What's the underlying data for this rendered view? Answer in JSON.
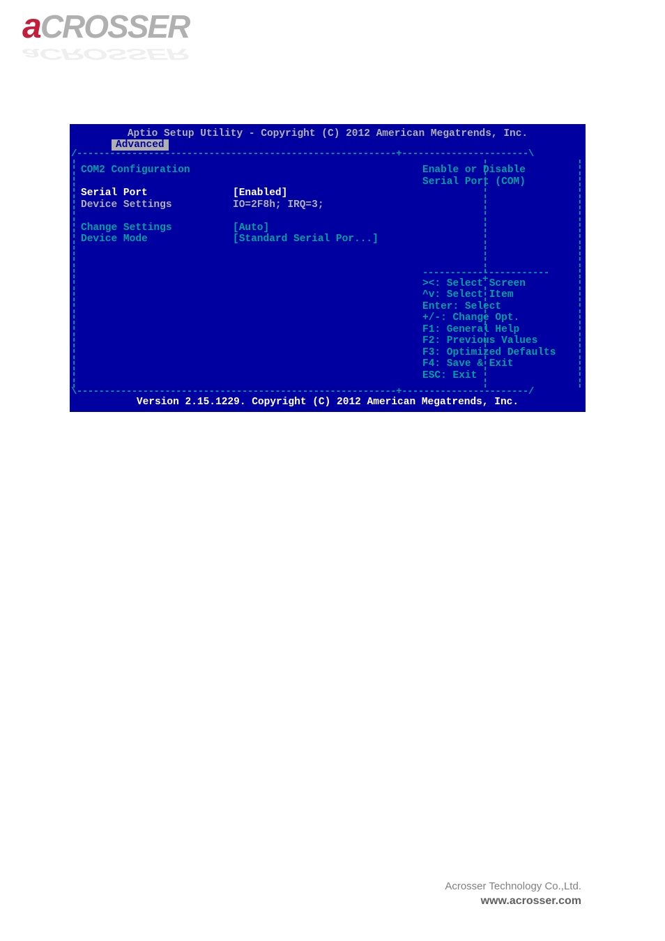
{
  "logo": {
    "first_letter": "a",
    "rest": "CROSSER"
  },
  "bios": {
    "header": "Aptio Setup Utility - Copyright (C) 2012 American Megatrends, Inc.",
    "tab": "Advanced",
    "section_title": "COM2 Configuration",
    "rows": {
      "serial_port": {
        "label": "Serial Port",
        "value": "[Enabled]"
      },
      "device_settings": {
        "label": "Device Settings",
        "value": "IO=2F8h; IRQ=3;"
      },
      "change_settings": {
        "label": "Change Settings",
        "value": "[Auto]"
      },
      "device_mode": {
        "label": "Device Mode",
        "value": "[Standard Serial Por...]"
      }
    },
    "help_text": {
      "line1": "Enable or Disable",
      "line2": "Serial Port (COM)"
    },
    "keys": {
      "k1": "><: Select Screen",
      "k2": "^v: Select Item",
      "k3": "Enter: Select",
      "k4": "+/-: Change Opt.",
      "k5": "F1: General Help",
      "k6": "F2: Previous Values",
      "k7": "F3: Optimized Defaults",
      "k8": "F4: Save & Exit",
      "k9": "ESC: Exit"
    },
    "footer": "Version 2.15.1229. Copyright (C) 2012 American Megatrends, Inc."
  },
  "page_footer": {
    "company": "Acrosser Technology Co.,Ltd.",
    "url": "www.acrosser.com"
  }
}
